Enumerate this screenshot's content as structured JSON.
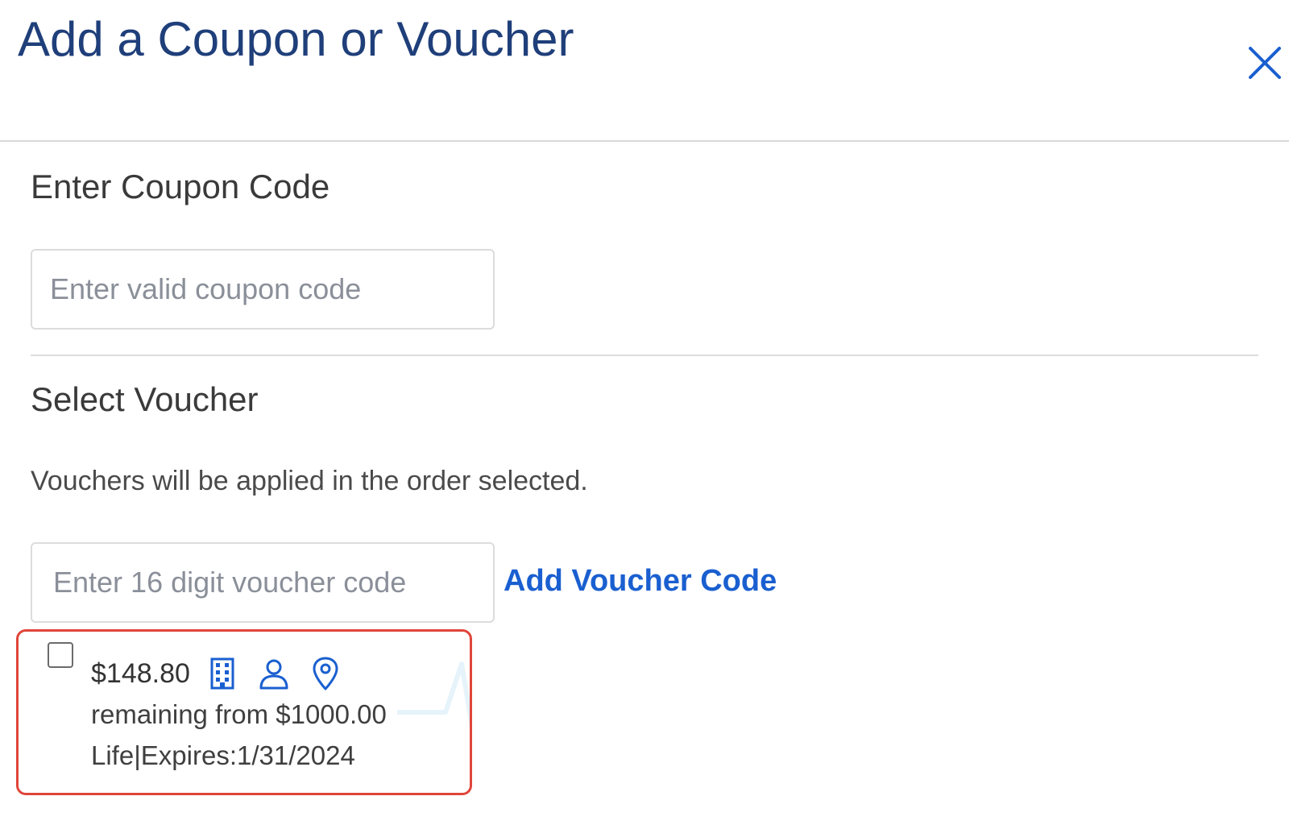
{
  "dialog": {
    "title": "Add a Coupon or Voucher",
    "close_icon": "close-icon"
  },
  "coupon": {
    "section_title": "Enter Coupon Code",
    "input_value": "",
    "input_placeholder": "Enter valid coupon code"
  },
  "voucher": {
    "section_title": "Select Voucher",
    "note": "Vouchers will be applied in the order selected.",
    "input_value": "",
    "input_placeholder": "Enter 16 digit voucher code",
    "add_link_label": "Add Voucher Code",
    "items": [
      {
        "checked": false,
        "amount": "$148.80",
        "icons": [
          "building-icon",
          "person-icon",
          "location-pin-icon"
        ],
        "remaining_text": "remaining from $1000.00",
        "expires_text": "Life|Expires:1/31/2024"
      }
    ]
  },
  "colors": {
    "title": "#1f3f7a",
    "accent": "#1a5fd0",
    "highlight_border": "#e0453a",
    "divider": "#d9d9d9"
  }
}
